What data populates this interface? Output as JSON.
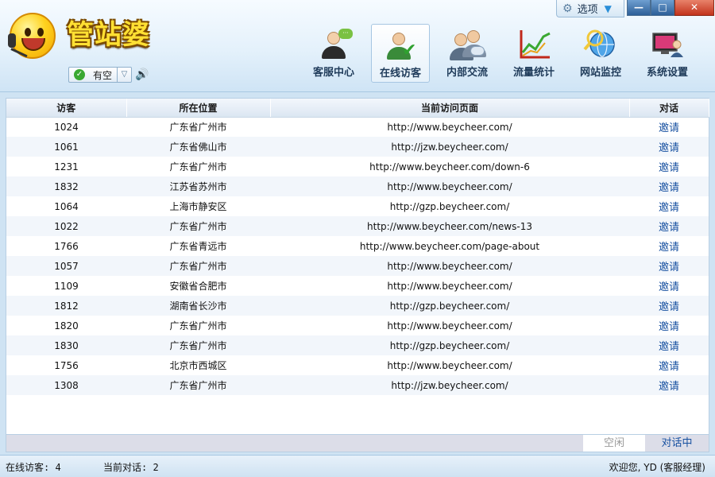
{
  "app": {
    "logo_text": "管站婆",
    "status": "有空"
  },
  "window_controls": {
    "options_label": "选项",
    "minimize": "—",
    "maximize": "□",
    "close": "✕"
  },
  "nav": [
    {
      "label": "客服中心",
      "icon": "customer-service-icon",
      "active": false
    },
    {
      "label": "在线访客",
      "icon": "online-visitor-icon",
      "active": true
    },
    {
      "label": "内部交流",
      "icon": "internal-chat-icon",
      "active": false
    },
    {
      "label": "流量统计",
      "icon": "traffic-stats-icon",
      "active": false
    },
    {
      "label": "网站监控",
      "icon": "site-monitor-icon",
      "active": false
    },
    {
      "label": "系统设置",
      "icon": "system-settings-icon",
      "active": false
    }
  ],
  "table": {
    "headers": [
      "访客",
      "所在位置",
      "当前访问页面",
      "对话"
    ],
    "invite_label": "邀请",
    "rows": [
      {
        "id": "1024",
        "location": "广东省广州市",
        "page": "http://www.beycheer.com/"
      },
      {
        "id": "1061",
        "location": "广东省佛山市",
        "page": "http://jzw.beycheer.com/"
      },
      {
        "id": "1231",
        "location": "广东省广州市",
        "page": "http://www.beycheer.com/down-6"
      },
      {
        "id": "1832",
        "location": "江苏省苏州市",
        "page": "http://www.beycheer.com/"
      },
      {
        "id": "1064",
        "location": "上海市静安区",
        "page": "http://gzp.beycheer.com/"
      },
      {
        "id": "1022",
        "location": "广东省广州市",
        "page": "http://www.beycheer.com/news-13"
      },
      {
        "id": "1766",
        "location": "广东省青远市",
        "page": "http://www.beycheer.com/page-about"
      },
      {
        "id": "1057",
        "location": "广东省广州市",
        "page": "http://www.beycheer.com/"
      },
      {
        "id": "1109",
        "location": "安徽省合肥市",
        "page": "http://www.beycheer.com/"
      },
      {
        "id": "1812",
        "location": "湖南省长沙市",
        "page": "http://gzp.beycheer.com/"
      },
      {
        "id": "1820",
        "location": "广东省广州市",
        "page": "http://www.beycheer.com/"
      },
      {
        "id": "1830",
        "location": "广东省广州市",
        "page": "http://gzp.beycheer.com/"
      },
      {
        "id": "1756",
        "location": "北京市西城区",
        "page": "http://www.beycheer.com/"
      },
      {
        "id": "1308",
        "location": "广东省广州市",
        "page": "http://jzw.beycheer.com/"
      }
    ]
  },
  "footer_tabs": {
    "idle": "空闲",
    "chatting": "对话中"
  },
  "statusbar": {
    "online_visitors": "在线访客: 4",
    "current_chats": "当前对话: 2",
    "welcome": "欢迎您, YD (客服经理)"
  },
  "colors": {
    "accent": "#1750a0",
    "header_bg": "#e4f1fb",
    "close_button": "#c2331c"
  }
}
